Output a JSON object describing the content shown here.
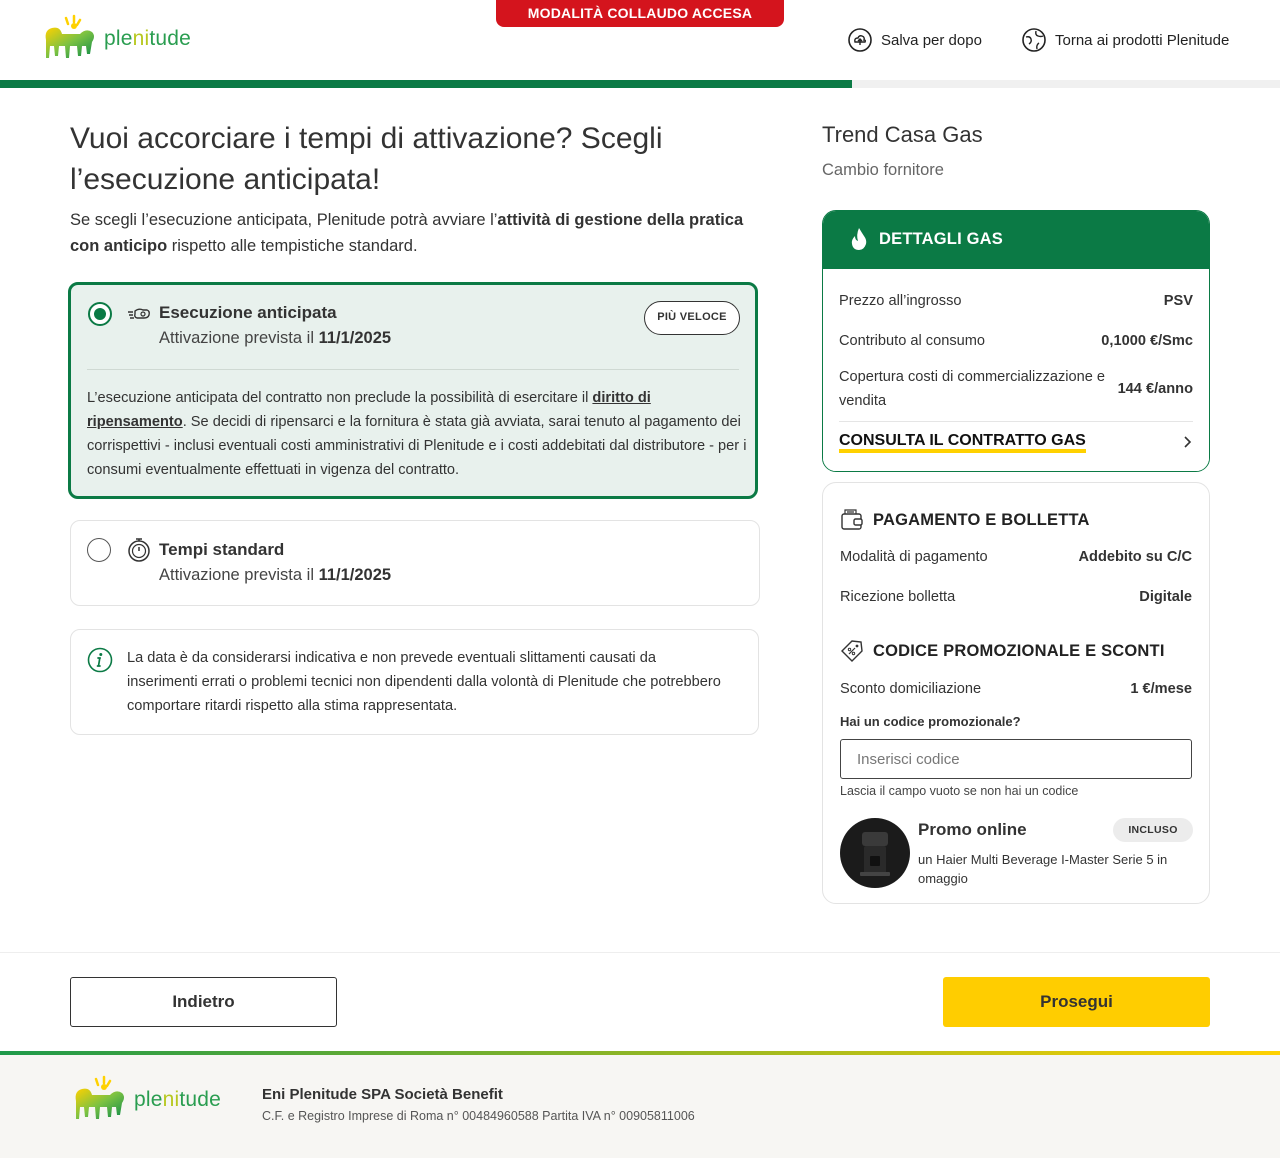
{
  "header": {
    "logo_text_pre": "ple",
    "logo_text_mid": "ni",
    "logo_text_post": "tude",
    "test_banner": "MODALITÀ COLLAUDO ACCESA",
    "save_later": "Salva per dopo",
    "back_to_products": "Torna ai prodotti Plenitude",
    "progress_percent": 66.6
  },
  "main": {
    "title": "Vuoi accorciare i tempi di attivazione? Scegli l’esecuzione anticipata!",
    "intro_pre": "Se scegli l’esecuzione anticipata, Plenitude potrà avviare l’",
    "intro_bold": "attività di gestione della pratica con anticipo",
    "intro_post": " rispetto alle tempistiche standard.",
    "options": [
      {
        "title": "Esecuzione anticipata",
        "sub_pre": "Attivazione prevista il ",
        "date": "11/1/2025",
        "badge": "PIÙ VELOCE",
        "selected": true,
        "desc_pre": "L’esecuzione anticipata del contratto non preclude la possibilità di esercitare il ",
        "desc_link": "diritto di ripensamento",
        "desc_post": ". Se decidi di ripensarci e la fornitura è stata già avviata, sarai tenuto al pagamento dei corrispettivi - inclusi eventuali costi amministrativi di Plenitude e i costi addebitati dal distributore - per i consumi eventualmente effettuati in vigenza del contratto."
      },
      {
        "title": "Tempi standard",
        "sub_pre": "Attivazione prevista il ",
        "date": "11/1/2025",
        "selected": false
      }
    ],
    "info": "La data è da considerarsi indicativa e non prevede eventuali slittamenti causati da inserimenti errati o problemi tecnici non dipendenti dalla volontà di Plenitude che potrebbero comportare ritardi rispetto alla stima rappresentata."
  },
  "summary": {
    "offer_title": "Trend Casa Gas",
    "offer_sub": "Cambio fornitore",
    "gas": {
      "title": "DETTAGLI GAS",
      "rows": [
        {
          "label": "Prezzo all’ingrosso",
          "value": "PSV"
        },
        {
          "label": "Contributo al consumo",
          "value": "0,1000 €/Smc"
        },
        {
          "label": "Copertura costi di commercializzazione e vendita",
          "value": "144 €/anno"
        }
      ],
      "link": "CONSULTA IL CONTRATTO GAS"
    },
    "payment": {
      "title": "PAGAMENTO E BOLLETTA",
      "rows": [
        {
          "label": "Modalità di pagamento",
          "value": "Addebito su C/C"
        },
        {
          "label": "Ricezione bolletta",
          "value": "Digitale"
        }
      ]
    },
    "promo": {
      "title": "CODICE PROMOZIONALE E SCONTI",
      "rows": [
        {
          "label": "Sconto domiciliazione",
          "value": "1 €/mese"
        }
      ],
      "question": "Hai un codice promozionale?",
      "placeholder": "Inserisci codice",
      "hint": "Lascia il campo vuoto se non hai un codice",
      "online_title": "Promo online",
      "online_badge": "INCLUSO",
      "online_desc": "un Haier Multi Beverage I-Master Serie 5 in omaggio"
    }
  },
  "nav": {
    "back": "Indietro",
    "next": "Prosegui"
  },
  "footer": {
    "company": "Eni Plenitude SPA Società Benefit",
    "legal": "C.F. e Registro Imprese di Roma n° 00484960588 Partita IVA n° 00905811006"
  },
  "colors": {
    "brand_green": "#0b7a45",
    "accent_yellow": "#ffcd00",
    "banner_red": "#d4141d"
  },
  "icons": [
    "six-legged-dog-logo",
    "cloud-save-icon",
    "globe-arrow-icon",
    "speed-icon",
    "stopwatch-icon",
    "info-icon",
    "flame-icon",
    "chevron-right-icon",
    "wallet-icon",
    "discount-tag-icon"
  ]
}
